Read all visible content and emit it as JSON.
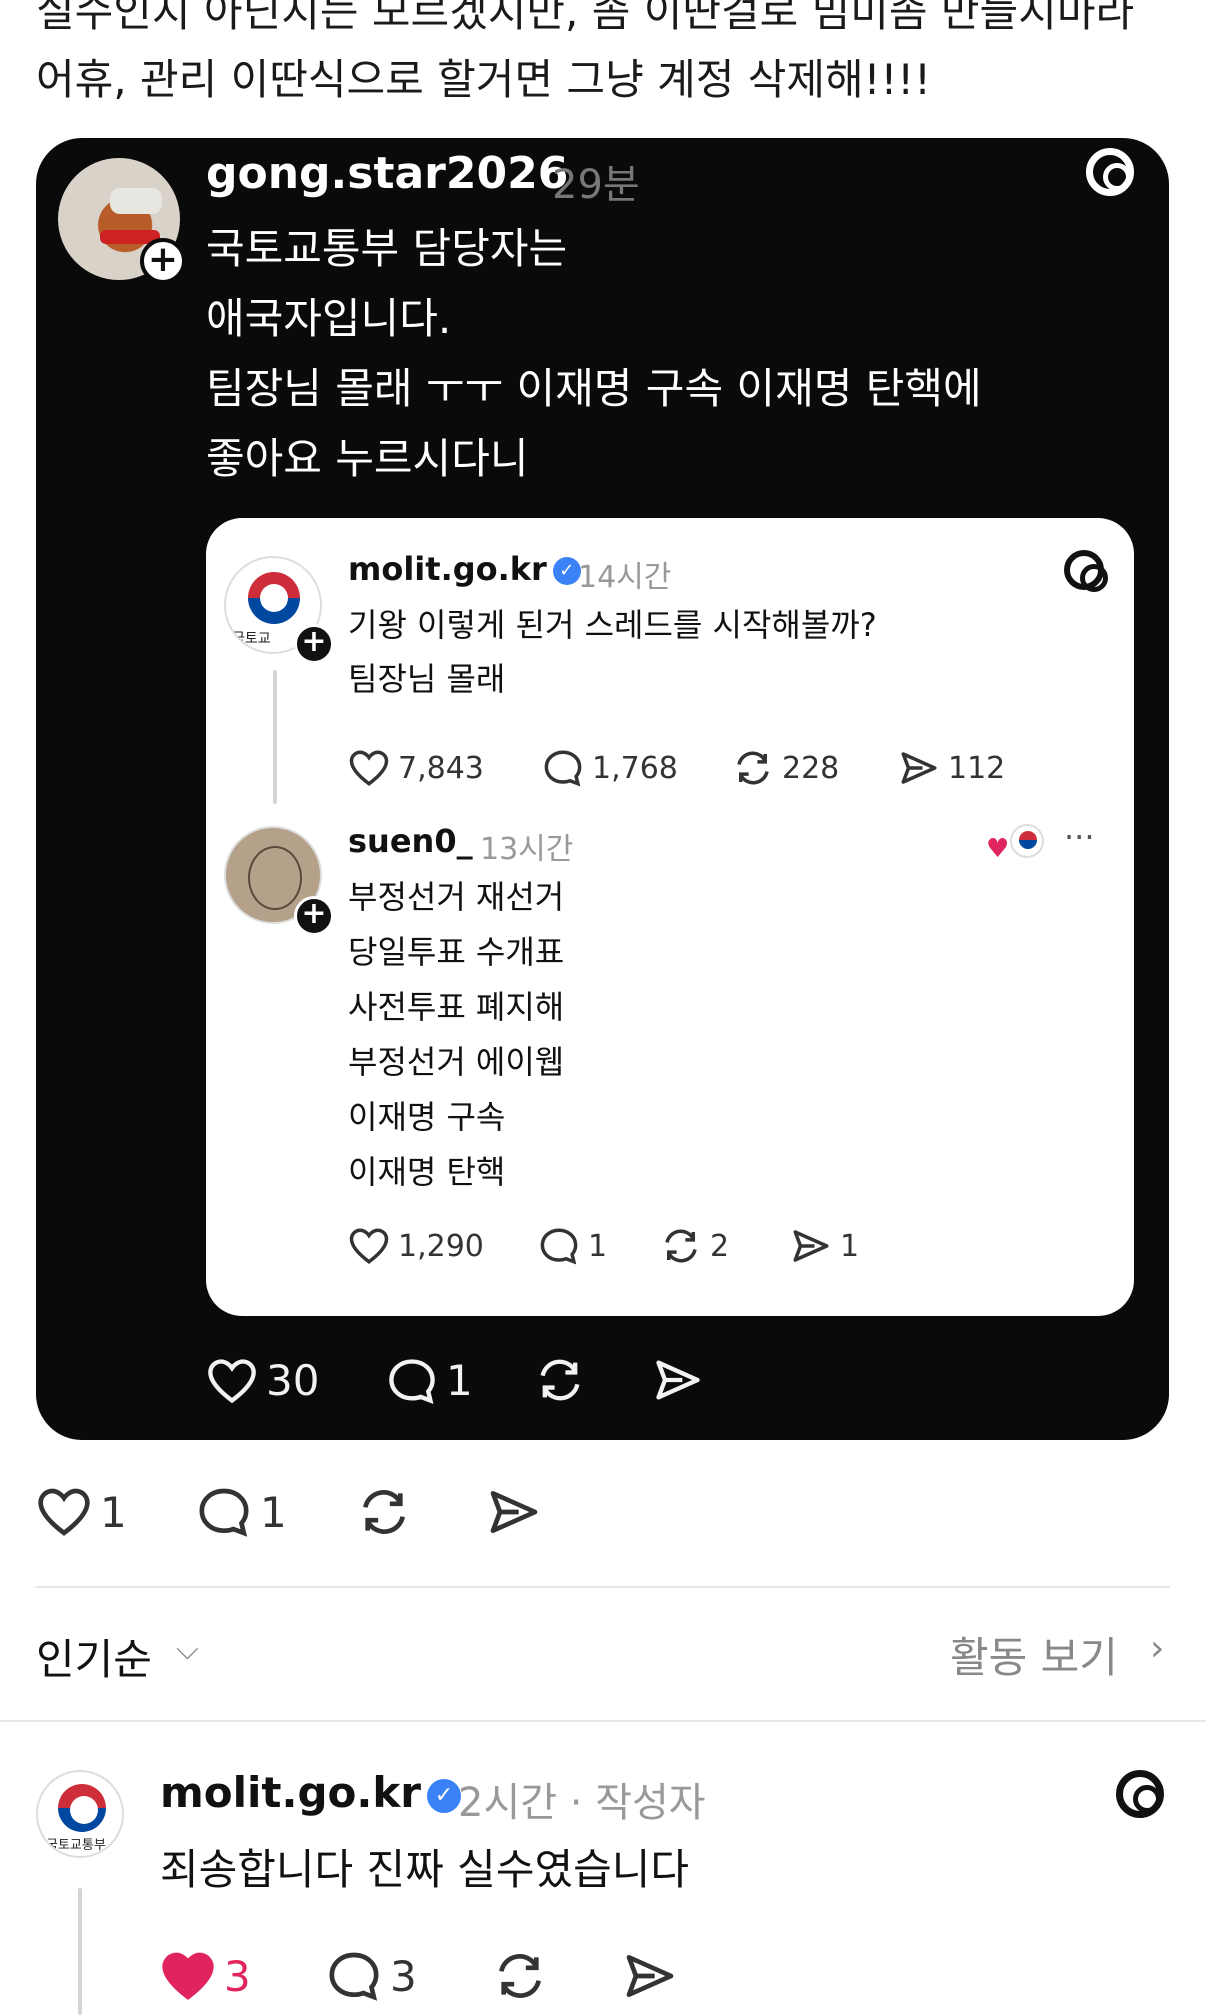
{
  "top_caption": {
    "line1": "실수인지 아닌지는 모르겠지만, 좀 이딴걸로 밈미좀 만들지마라",
    "line2": "어휴, 관리 이딴식으로 할거면 그냥 계정 삭제해!!!!"
  },
  "repost_card": {
    "username": "gong.star2026",
    "time": "29분",
    "body": [
      "국토교통부 담당자는",
      "애국자입니다.",
      "팀장님 몰래 ㅜㅜ 이재명 구속 이재명 탄핵에",
      "좋아요 누르시다니"
    ],
    "quoted": {
      "post": {
        "username": "molit.go.kr",
        "time": "14시간",
        "avatar_caption": "국토교",
        "lines": [
          "기왕 이렇게 된거 스레드를 시작해볼까?",
          "팀장님 몰래"
        ],
        "likes": "7,843",
        "replies": "1,768",
        "reposts": "228",
        "shares": "112"
      },
      "reply": {
        "username": "suen0_",
        "time": "13시간",
        "more": "···",
        "lines": [
          "부정선거 재선거",
          "당일투표 수개표",
          "사전투표 폐지해",
          "부정선거 에이웹",
          "이재명 구속",
          "이재명 탄핵"
        ],
        "likes": "1,290",
        "replies": "1",
        "reposts": "2",
        "shares": "1"
      }
    },
    "likes": "30",
    "replies": "1"
  },
  "post_stats": {
    "likes": "1",
    "replies": "1"
  },
  "sort": {
    "label": "인기순",
    "chevron": "⌵",
    "activity": "활동 보기",
    "activity_chevron": "›"
  },
  "comment": {
    "username": "molit.go.kr",
    "meta": "2시간 · 작성자",
    "avatar_caption": "국토교통부",
    "text": "죄송합니다 진짜 실수였습니다",
    "likes": "3",
    "replies": "3",
    "like_color": "#e0245e"
  },
  "colors": {
    "card_bg": "#0a0a0a",
    "verified": "#3b82f6",
    "muted": "#999999"
  },
  "icons": [
    "heart-icon",
    "comment-icon",
    "repost-icon",
    "share-icon",
    "threads-icon",
    "verified-icon",
    "plus-icon"
  ]
}
